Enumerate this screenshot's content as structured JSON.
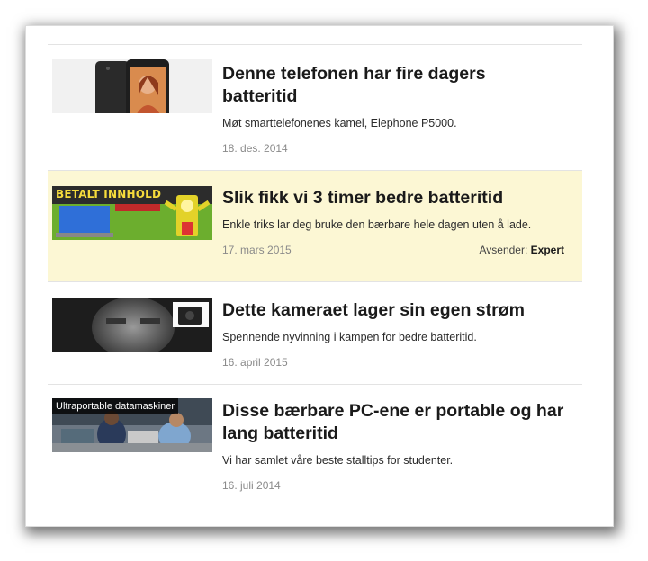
{
  "articles": [
    {
      "title": "Denne telefonen har fire dagers batteritid",
      "lead": "Møt smarttelefonenes kamel, Elephone P5000.",
      "date": "18. des. 2014",
      "thumb_icon": "smartphone-image"
    },
    {
      "title": "Slik fikk vi 3 timer bedre batteritid",
      "lead": "Enkle triks lar deg bruke den bærbare hele dagen uten å lade.",
      "date": "17. mars 2015",
      "thumb_label": "BETALT INNHOLD",
      "sender_label": "Avsender:",
      "sender_name": "Expert",
      "thumb_icon": "laptop-battery-mascot-image",
      "highlight_color": "#fcf7d4"
    },
    {
      "title": "Dette kameraet lager sin egen strøm",
      "lead": "Spennende nyvinning i kampen for bedre batteritid.",
      "date": "16. april 2015",
      "thumb_icon": "camera-face-image"
    },
    {
      "title": "Disse bærbare PC-ene er portable og har lang batteritid",
      "lead": "Vi har samlet våre beste stalltips for studenter.",
      "date": "16. juli 2014",
      "thumb_label": "Ultraportable datamaskiner",
      "thumb_icon": "students-laptop-image"
    }
  ]
}
